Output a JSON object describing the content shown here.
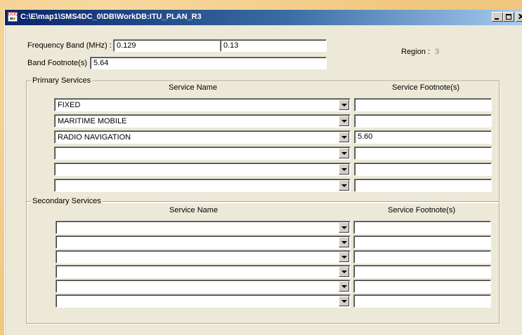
{
  "window": {
    "title": "C:\\E\\map1\\SMS4DC_0\\DB\\WorkDB:ITU_PLAN_R3",
    "icon": "doc-app-icon",
    "icon_text": "DOC"
  },
  "band": {
    "frequency_label": "Frequency Band (MHz) :",
    "frequency_low": "0.129",
    "frequency_high": "0.13",
    "footnote_label": "Band Footnote(s) :",
    "footnote_value": "5.64",
    "region_label": "Region :",
    "region_value": "3"
  },
  "primary": {
    "title": "Primary Services",
    "col_service": "Service Name",
    "col_footnote": "Service Footnote(s)",
    "rows": [
      {
        "service": "FIXED",
        "footnote": ""
      },
      {
        "service": "MARITIME MOBILE",
        "footnote": ""
      },
      {
        "service": "RADIO NAVIGATION",
        "footnote": "5.60"
      },
      {
        "service": "",
        "footnote": ""
      },
      {
        "service": "",
        "footnote": ""
      },
      {
        "service": "",
        "footnote": ""
      }
    ]
  },
  "secondary": {
    "title": "Secondary Services",
    "col_service": "Service Name",
    "col_footnote": "Service Footnote(s)",
    "rows": [
      {
        "service": "",
        "footnote": ""
      },
      {
        "service": "",
        "footnote": ""
      },
      {
        "service": "",
        "footnote": ""
      },
      {
        "service": "",
        "footnote": ""
      },
      {
        "service": "",
        "footnote": ""
      },
      {
        "service": "",
        "footnote": ""
      }
    ]
  }
}
